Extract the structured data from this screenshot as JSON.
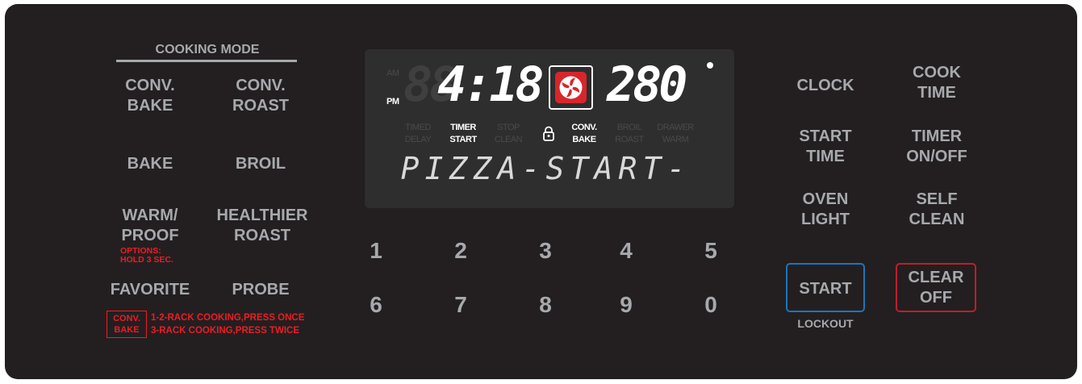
{
  "cooking_mode": {
    "header": "COOKING MODE",
    "conv_bake": "CONV.\nBAKE",
    "conv_roast": "CONV.\nROAST",
    "bake": "BAKE",
    "broil": "BROIL",
    "warm_proof": "WARM/\nPROOF",
    "warm_proof_note": "OPTIONS:\nHOLD 3 SEC.",
    "healthier_roast": "HEALTHIER\nROAST",
    "favorite": "FAVORITE",
    "probe": "PROBE",
    "conv_bake_badge": "CONV.\nBAKE",
    "rack_note": "1-2-RACK COOKING,PRESS ONCE\n3-RACK COOKING,PRESS TWICE"
  },
  "display": {
    "am": "AM",
    "pm": "PM",
    "clock_ghost": "88",
    "clock_value": "4:18",
    "temperature": "280",
    "degree": "°",
    "indicators": {
      "timed_delay": "TIMED\nDELAY",
      "timer_start": "TIMER\nSTART",
      "stop_clean": "STOP\nCLEAN",
      "conv_bake": "CONV.\nBAKE",
      "broil_roast": "BROIL\nROAST",
      "drawer_warm": "DRAWER\nWARM"
    },
    "message": "PIZZA-START-"
  },
  "keypad": [
    "1",
    "2",
    "3",
    "4",
    "5",
    "6",
    "7",
    "8",
    "9",
    "0"
  ],
  "controls": {
    "clock": "CLOCK",
    "cook_time": "COOK\nTIME",
    "start_time": "START\nTIME",
    "timer_on_off": "TIMER\nON/OFF",
    "oven_light": "OVEN\nLIGHT",
    "self_clean": "SELF\nCLEAN",
    "start": "START",
    "lockout": "LOCKOUT",
    "clear_off": "CLEAR\nOFF"
  },
  "colors": {
    "panel": "#231f20",
    "label": "#a7a9ac",
    "accent_red": "#ed1c24",
    "start_blue": "#1b75bc",
    "clear_red": "#be1e2d"
  }
}
